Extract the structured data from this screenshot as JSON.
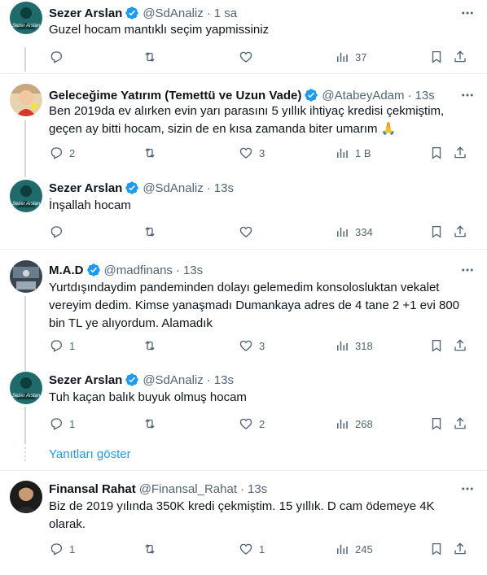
{
  "colors": {
    "accent": "#1d9bf0",
    "muted": "#536471",
    "text": "#0f1419",
    "thread": "#cfd9de",
    "verified": "#1d9bf0"
  },
  "tweets": [
    {
      "name": "Sezer Arslan",
      "verified": true,
      "handle": "@SdAnaliz",
      "time": "1 sa",
      "text": "Guzel hocam mantıklı seçim yapmissiniz",
      "replies": "",
      "retweets": "",
      "likes": "",
      "views": "37",
      "avatar_icon": "sezer-arslan-logo-avatar",
      "avatar_text": "Sezer Arslan"
    },
    {
      "name": "Geleceğime Yatırım (Temettü ve Uzun Vade)",
      "verified": true,
      "handle": "@AtabeyAdam",
      "time": "13s",
      "text": "Ben 2019da ev alırken evin yarı parasını 5 yıllık ihtiyaç kredisi çekmiştim, geçen ay bitti hocam, sizin de en kısa zamanda biter umarım 🙏",
      "replies": "2",
      "retweets": "",
      "likes": "3",
      "views": "1 B",
      "avatar_icon": "child-photo-avatar"
    },
    {
      "name": "Sezer Arslan",
      "verified": true,
      "handle": "@SdAnaliz",
      "time": "13s",
      "text": "İnşallah hocam",
      "replies": "",
      "retweets": "",
      "likes": "",
      "views": "334",
      "avatar_icon": "sezer-arslan-logo-avatar",
      "avatar_text": "Sezer Arslan"
    },
    {
      "name": "M.A.D",
      "verified": true,
      "handle": "@madfinans",
      "time": "13s",
      "text": "Yurtdışındaydim pandeminden dolayı gelemedim konsolosluktan vekalet vereyim dedim. Kimse yanaşmadı Dumankaya adres de  4 tane 2 +1 evi 800 bin TL ye alıyordum.  Alamadık",
      "replies": "1",
      "retweets": "",
      "likes": "3",
      "views": "318",
      "avatar_icon": "desk-photo-avatar"
    },
    {
      "name": "Sezer Arslan",
      "verified": true,
      "handle": "@SdAnaliz",
      "time": "13s",
      "text": "Tuh kaçan balık buyuk olmuş hocam",
      "replies": "1",
      "retweets": "",
      "likes": "2",
      "views": "268",
      "avatar_icon": "sezer-arslan-logo-avatar",
      "avatar_text": "Sezer Arslan"
    },
    {
      "name": "Finansal Rahat",
      "verified": false,
      "handle": "@Finansal_Rahat",
      "time": "13s",
      "text": "Biz de 2019 yılında 350K kredi çekmiştim. 15 yıllık. D cam ödemeye 4K olarak.",
      "replies": "1",
      "retweets": "",
      "likes": "1",
      "views": "245",
      "avatar_icon": "man-portrait-avatar"
    }
  ],
  "show_replies_label": "Yanıtları göster",
  "date_separator": "·"
}
